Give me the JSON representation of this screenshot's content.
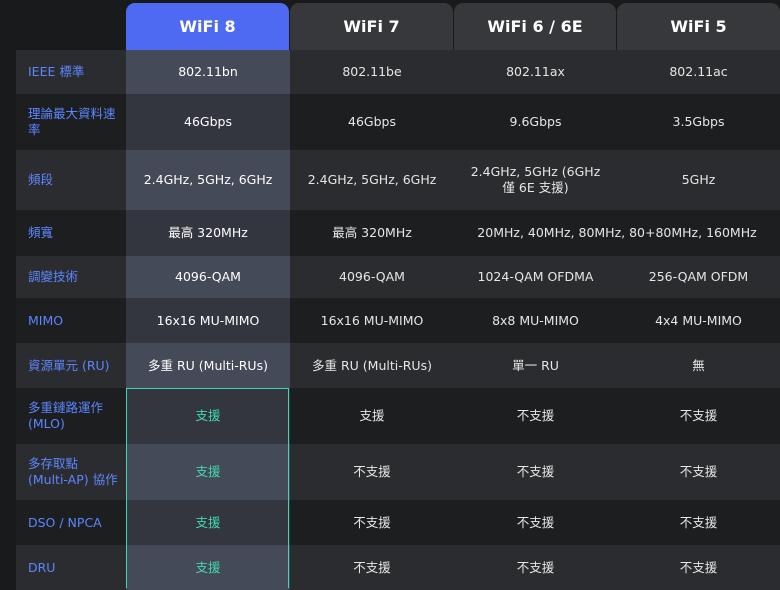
{
  "headers": [
    "WiFi 8",
    "WiFi 7",
    "WiFi 6 / 6E",
    "WiFi 5"
  ],
  "rows": [
    {
      "label": "IEEE 標準",
      "cells": [
        "802.11bn",
        "802.11be",
        "802.11ax",
        "802.11ac"
      ]
    },
    {
      "label": "理論最大資料速率",
      "cells": [
        "46Gbps",
        "46Gbps",
        "9.6Gbps",
        "3.5Gbps"
      ]
    },
    {
      "label": "頻段",
      "cells": [
        "2.4GHz, 5GHz, 6GHz",
        "2.4GHz, 5GHz, 6GHz",
        "2.4GHz, 5GHz (6GHz 僅 6E 支援)",
        "5GHz"
      ]
    },
    {
      "label": "頻寬",
      "cells": [
        "最高 320MHz",
        "最高 320MHz",
        "20MHz, 40MHz, 80MHz, 80+80MHz, 160MHz"
      ]
    },
    {
      "label": "調變技術",
      "cells": [
        "4096-QAM",
        "4096-QAM",
        "1024-QAM OFDMA",
        "256-QAM OFDM"
      ]
    },
    {
      "label": "MIMO",
      "cells": [
        "16x16 MU-MIMO",
        "16x16 MU-MIMO",
        "8x8 MU-MIMO",
        "4x4 MU-MIMO"
      ]
    },
    {
      "label": "資源單元 (RU)",
      "cells": [
        "多重 RU (Multi-RUs)",
        "多重 RU (Multi-RUs)",
        "單一 RU",
        "無"
      ]
    },
    {
      "label": "多重鏈路運作 (MLO)",
      "cells": [
        "支援",
        "支援",
        "不支援",
        "不支援"
      ]
    },
    {
      "label": "多存取點 (Multi-AP) 協作",
      "cells": [
        "支援",
        "不支援",
        "不支援",
        "不支援"
      ]
    },
    {
      "label": "DSO / NPCA",
      "cells": [
        "支援",
        "不支援",
        "不支援",
        "不支援"
      ]
    },
    {
      "label": "DRU",
      "cells": [
        "支援",
        "不支援",
        "不支援",
        "不支援"
      ]
    }
  ],
  "colors": {
    "highlight_header": "#4f6af2",
    "label_text": "#5c86ff",
    "support_text": "#43d9b0"
  }
}
